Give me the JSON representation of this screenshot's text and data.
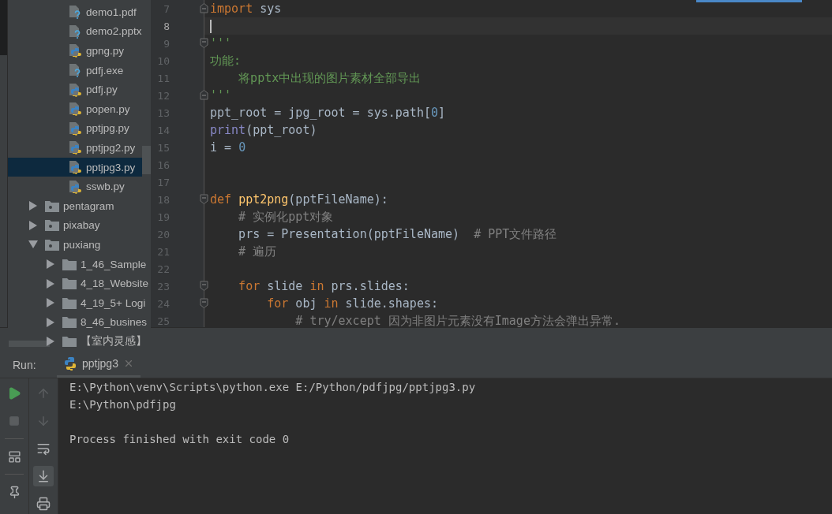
{
  "project_tree": {
    "items": [
      {
        "kind": "unknown_file",
        "label": "demo1.pdf",
        "selected": false
      },
      {
        "kind": "unknown_file",
        "label": "demo2.pptx",
        "selected": false
      },
      {
        "kind": "python_file",
        "label": "gpng.py",
        "selected": false
      },
      {
        "kind": "unknown_file",
        "label": "pdfj.exe",
        "selected": false
      },
      {
        "kind": "python_file",
        "label": "pdfj.py",
        "selected": false
      },
      {
        "kind": "python_file",
        "label": "popen.py",
        "selected": false
      },
      {
        "kind": "python_file",
        "label": "pptjpg.py",
        "selected": false
      },
      {
        "kind": "python_file",
        "label": "pptjpg2.py",
        "selected": false
      },
      {
        "kind": "python_file",
        "label": "pptjpg3.py",
        "selected": true
      },
      {
        "kind": "python_file",
        "label": "sswb.py",
        "selected": false
      },
      {
        "kind": "folder",
        "label": "pentagram",
        "expanded": false,
        "selected": false
      },
      {
        "kind": "folder",
        "label": "pixabay",
        "expanded": false,
        "selected": false
      },
      {
        "kind": "folder",
        "label": "puxiang",
        "expanded": true,
        "selected": false,
        "children": [
          {
            "kind": "folder",
            "label": "1_46_Sample",
            "expanded": false,
            "selected": false
          },
          {
            "kind": "folder",
            "label": "4_18_Website",
            "expanded": false,
            "selected": false
          },
          {
            "kind": "folder",
            "label": "4_19_5+ Logi",
            "expanded": false,
            "selected": false
          },
          {
            "kind": "folder",
            "label": "8_46_busines",
            "expanded": false,
            "selected": false
          },
          {
            "kind": "folder",
            "label": "【室内灵感】",
            "expanded": false,
            "selected": false
          }
        ]
      }
    ]
  },
  "editor": {
    "lines": [
      {
        "number": "7",
        "current": false,
        "fold_close": true,
        "tokens": [
          {
            "kind": "keyword",
            "text": "import"
          },
          {
            "kind": "plain",
            "text": " sys"
          }
        ]
      },
      {
        "number": "8",
        "current": true
      },
      {
        "number": "9",
        "current": false,
        "fold_open": true,
        "tokens": [
          {
            "kind": "docstring",
            "text": "'''"
          }
        ]
      },
      {
        "number": "10",
        "current": false,
        "tokens": [
          {
            "kind": "docstring",
            "text": "功能:"
          }
        ]
      },
      {
        "number": "11",
        "current": false,
        "tokens": [
          {
            "kind": "docstring",
            "text": "    将pptx中出现的图片素材全部导出"
          }
        ]
      },
      {
        "number": "12",
        "current": false,
        "fold_close": true,
        "tokens": [
          {
            "kind": "docstring",
            "text": "'''"
          }
        ]
      },
      {
        "number": "13",
        "current": false,
        "tokens": [
          {
            "kind": "plain",
            "text": "ppt_root = jpg_root = sys.path["
          },
          {
            "kind": "number",
            "text": "0"
          },
          {
            "kind": "plain",
            "text": "]"
          }
        ]
      },
      {
        "number": "14",
        "current": false,
        "tokens": [
          {
            "kind": "builtin",
            "text": "print"
          },
          {
            "kind": "plain",
            "text": "(ppt_root)"
          }
        ]
      },
      {
        "number": "15",
        "current": false,
        "tokens": [
          {
            "kind": "plain",
            "text": "i = "
          },
          {
            "kind": "number",
            "text": "0"
          }
        ]
      },
      {
        "number": "16",
        "current": false
      },
      {
        "number": "17",
        "current": false
      },
      {
        "number": "18",
        "current": false,
        "fold_open": true,
        "tokens": [
          {
            "kind": "keyword",
            "text": "def "
          },
          {
            "kind": "function",
            "text": "ppt2png"
          },
          {
            "kind": "plain",
            "text": "(pptFileName):"
          }
        ]
      },
      {
        "number": "19",
        "current": false,
        "tokens": [
          {
            "kind": "comment",
            "text": "    # 实例化ppt对象"
          }
        ]
      },
      {
        "number": "20",
        "current": false,
        "tokens": [
          {
            "kind": "plain",
            "text": "    prs = Presentation(pptFileName)  "
          },
          {
            "kind": "comment",
            "text": "# PPT文件路径"
          }
        ]
      },
      {
        "number": "21",
        "current": false,
        "tokens": [
          {
            "kind": "comment",
            "text": "    # 遍历"
          }
        ]
      },
      {
        "number": "22",
        "current": false
      },
      {
        "number": "23",
        "current": false,
        "fold_open": true,
        "tokens": [
          {
            "kind": "keyword",
            "text": "    for"
          },
          {
            "kind": "plain",
            "text": " slide "
          },
          {
            "kind": "keyword",
            "text": "in"
          },
          {
            "kind": "plain",
            "text": " prs.slides:"
          }
        ]
      },
      {
        "number": "24",
        "current": false,
        "fold_open": true,
        "tokens": [
          {
            "kind": "keyword",
            "text": "        for"
          },
          {
            "kind": "plain",
            "text": " obj "
          },
          {
            "kind": "keyword",
            "text": "in"
          },
          {
            "kind": "plain",
            "text": " slide.shapes:"
          }
        ]
      },
      {
        "number": "25",
        "current": false,
        "tokens": [
          {
            "kind": "comment",
            "text": "            # try/except 因为非图片元素没有Image方法会弹出异常."
          }
        ]
      }
    ]
  },
  "run_panel": {
    "label": "Run:",
    "tab": {
      "label": "pptjpg3",
      "selected": true
    },
    "output": [
      "E:\\Python\\venv\\Scripts\\python.exe E:/Python/pdfjpg/pptjpg3.py",
      "E:\\Python\\pdfjpg"
    ],
    "exit_message": "Process finished with exit code 0"
  }
}
